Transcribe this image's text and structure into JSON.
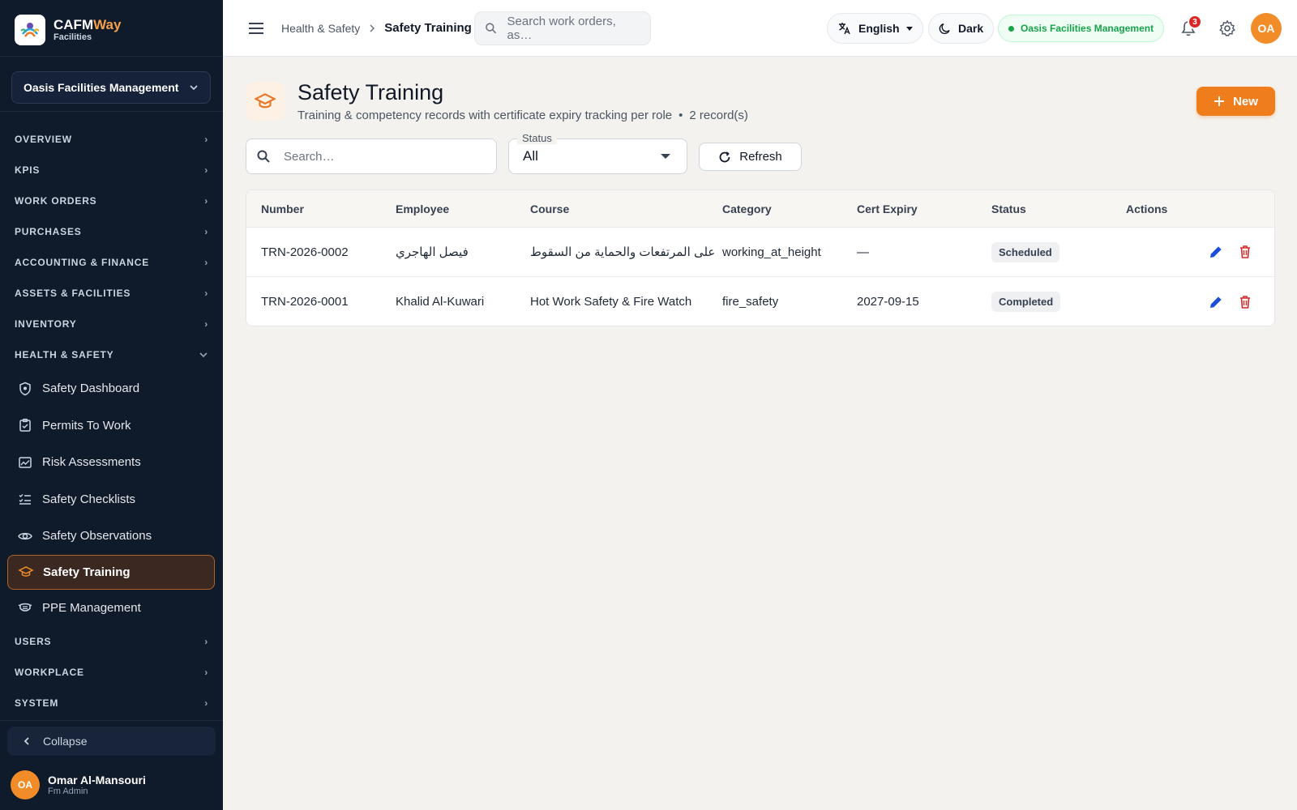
{
  "brand": {
    "name_a": "CAFM",
    "name_b": "Way",
    "sub": "Facilities"
  },
  "org_selector": {
    "value": "Oasis Facilities Management"
  },
  "nav": {
    "groups_top": [
      {
        "label": "OVERVIEW"
      },
      {
        "label": "KPIS"
      },
      {
        "label": "WORK ORDERS"
      },
      {
        "label": "PURCHASES"
      },
      {
        "label": "ACCOUNTING & FINANCE"
      },
      {
        "label": "ASSETS & FACILITIES"
      },
      {
        "label": "INVENTORY"
      }
    ],
    "open_group": {
      "label": "HEALTH & SAFETY"
    },
    "items": [
      {
        "label": "Safety Dashboard",
        "icon": "shield-icon"
      },
      {
        "label": "Permits To Work",
        "icon": "clipboard-check-icon"
      },
      {
        "label": "Risk Assessments",
        "icon": "image-chart-icon"
      },
      {
        "label": "Safety Checklists",
        "icon": "checklist-icon"
      },
      {
        "label": "Safety Observations",
        "icon": "eye-icon"
      },
      {
        "label": "Safety Training",
        "icon": "graduation-cap-icon",
        "active": true
      },
      {
        "label": "PPE Management",
        "icon": "mask-icon"
      }
    ],
    "groups_bottom": [
      {
        "label": "USERS"
      },
      {
        "label": "WORKPLACE"
      },
      {
        "label": "SYSTEM"
      }
    ],
    "collapse_label": "Collapse"
  },
  "user": {
    "initials": "OA",
    "name": "Omar Al-Mansouri",
    "role": "Fm Admin"
  },
  "topbar": {
    "breadcrumb_parent": "Health & Safety",
    "breadcrumb_current": "Safety Training",
    "search_placeholder": "Search work orders, as…",
    "language": "English",
    "theme": "Dark",
    "org": "Oasis Facilities Management",
    "notifications": "3",
    "avatar": "OA"
  },
  "page": {
    "title": "Safety Training",
    "subtitle": "Training & competency records with certificate expiry tracking per role",
    "bullet": "•",
    "count": "2 record(s)",
    "new_button": "New"
  },
  "filters": {
    "search_placeholder": "Search…",
    "status_label": "Status",
    "status_value": "All",
    "refresh_label": "Refresh"
  },
  "table": {
    "headers": [
      "Number",
      "Employee",
      "Course",
      "Category",
      "Cert Expiry",
      "Status",
      "Actions"
    ],
    "rows": [
      {
        "number": "TRN-2026-0002",
        "employee": "فيصل الهاجري",
        "course": "العمل على المرتفعات والحماية من السقوط",
        "category": "working_at_height",
        "expiry": "—",
        "status": "Scheduled"
      },
      {
        "number": "TRN-2026-0001",
        "employee": "Khalid Al-Kuwari",
        "course": "Hot Work Safety & Fire Watch",
        "category": "fire_safety",
        "expiry": "2027-09-15",
        "status": "Completed"
      }
    ]
  },
  "colors": {
    "accent": "#f07d1c",
    "sidebar": "#0f1a2b",
    "edit": "#1d4ed8",
    "delete": "#dc2626",
    "online": "#16a34a"
  }
}
